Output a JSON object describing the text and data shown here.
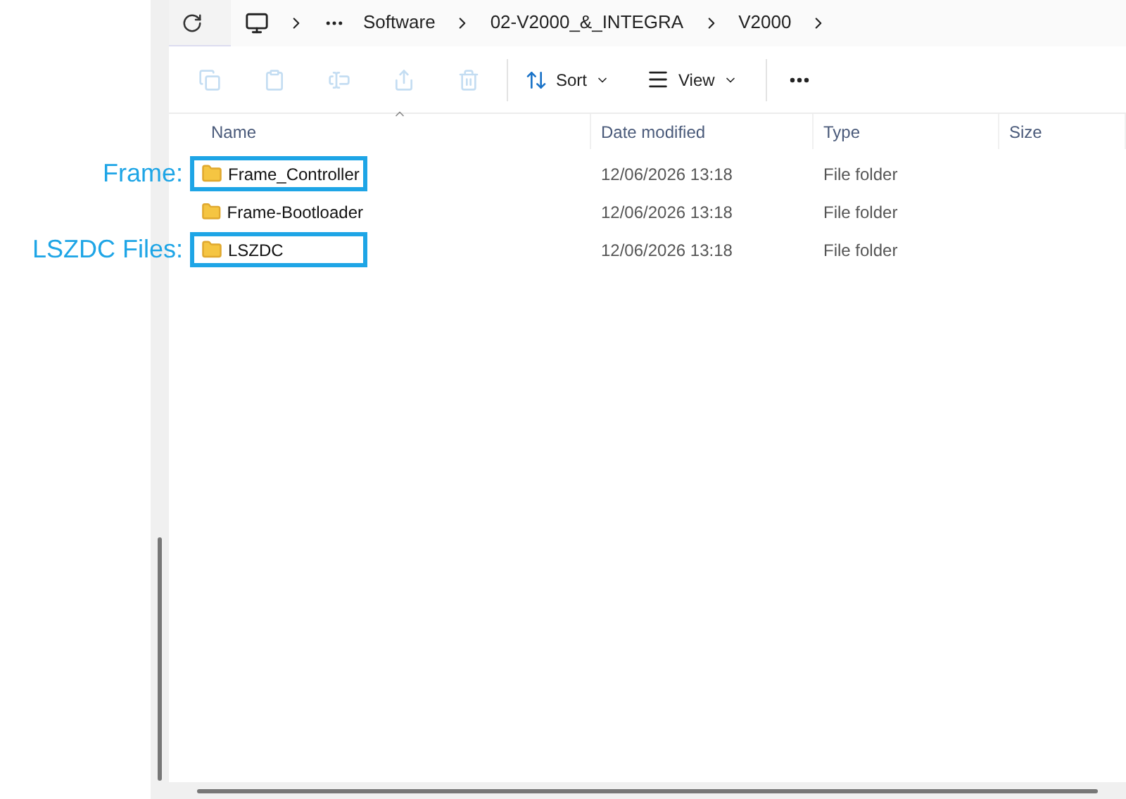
{
  "breadcrumb": [
    "Software",
    "02-V2000_&_INTEGRA",
    "V2000"
  ],
  "toolbar": {
    "buttons": [
      {
        "kind": "copy",
        "disabled": true
      },
      {
        "kind": "paste",
        "disabled": true
      },
      {
        "kind": "rename",
        "disabled": true
      },
      {
        "kind": "share",
        "disabled": true
      },
      {
        "kind": "delete",
        "disabled": true
      }
    ],
    "sort": "Sort",
    "view": "View"
  },
  "columns": [
    "Name",
    "Date modified",
    "Type",
    "Size"
  ],
  "rows": [
    {
      "name": "Frame_Controller",
      "date": "12/06/2026 13:18",
      "type": "File folder",
      "highlighted": true,
      "annotation": "Frame:"
    },
    {
      "name": "Frame-Bootloader",
      "date": "12/06/2026 13:18",
      "type": "File folder",
      "highlighted": false
    },
    {
      "name": "LSZDC",
      "date": "12/06/2026 13:18",
      "type": "File folder",
      "highlighted": true,
      "annotation": "LSZDC Files:"
    }
  ]
}
